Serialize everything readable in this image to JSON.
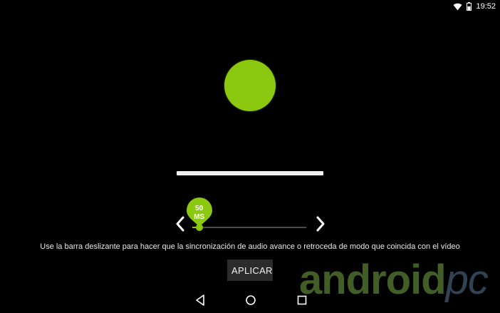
{
  "status_bar": {
    "time": "19:52",
    "icons": [
      "wifi-icon",
      "battery-icon"
    ]
  },
  "colors": {
    "accent": "#8cc810",
    "background": "#000000",
    "button": "#2b2b2b"
  },
  "indicator": {
    "icon": "green-circle"
  },
  "slider": {
    "value": "50",
    "unit": "MS",
    "fraction": 0.06,
    "prev_icon": "chevron-left-icon",
    "next_icon": "chevron-right-icon"
  },
  "help_text": "Use la barra deslizante para hacer que la sincronización de audio avance o retroceda de modo que coincida con el vídeo",
  "apply_button": {
    "label": "APLICAR"
  },
  "nav_bar": {
    "back_icon": "back-icon",
    "home_icon": "home-icon",
    "recents_icon": "recents-icon"
  },
  "watermark": {
    "part1": "android",
    "part2": "pc"
  }
}
